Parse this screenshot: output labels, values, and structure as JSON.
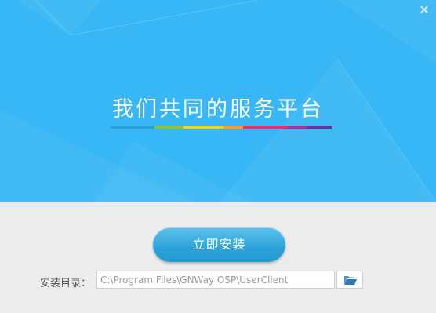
{
  "window": {
    "close_glyph": "✕"
  },
  "banner": {
    "slogan": "我们共同的服务平台",
    "background_color": "#37b7f5",
    "color_bar": [
      "#2aa0d8",
      "#8ac33f",
      "#e3d63a",
      "#f0a238",
      "#d23a6e",
      "#9b3a8e",
      "#5b3b9b"
    ]
  },
  "install": {
    "button_label": "立即安装",
    "dir_label": "安装目录：",
    "dir_value": "C:\\Program Files\\GNWay OSP\\UserClient",
    "browse_icon": "folder-open-icon"
  }
}
